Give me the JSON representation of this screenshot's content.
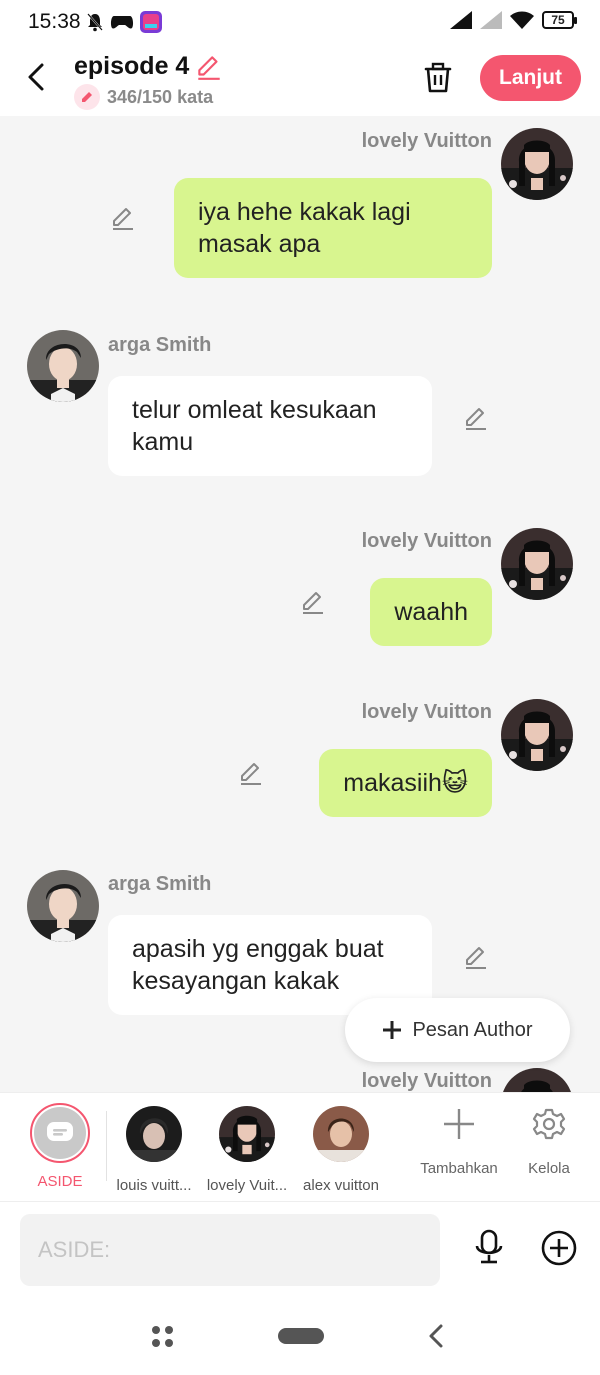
{
  "status": {
    "time": "15:38",
    "battery": "75",
    "left_icons": [
      "mute-bell-icon",
      "gamepad-icon",
      "app-notification-icon"
    ],
    "right_icons": [
      "signal-icon",
      "signal-weak-icon",
      "wifi-icon",
      "battery-icon"
    ]
  },
  "header": {
    "title": "episode 4",
    "word_count": "346/150 kata",
    "next_label": "Lanjut"
  },
  "messages": [
    {
      "sender": "lovely Vuitton",
      "text": "iya hehe kakak lagi masak apa",
      "side": "right"
    },
    {
      "sender": "arga Smith",
      "text": "telur omleat kesukaan kamu",
      "side": "left"
    },
    {
      "sender": "lovely Vuitton",
      "text": "waahh",
      "side": "right"
    },
    {
      "sender": "lovely Vuitton",
      "text": "makasiih😺",
      "side": "right"
    },
    {
      "sender": "arga Smith",
      "text": "apasih yg enggak buat kesayangan kakak",
      "side": "left"
    },
    {
      "sender": "lovely Vuitton",
      "text": "",
      "side": "right"
    }
  ],
  "author_button": "Pesan Author",
  "characters": {
    "aside_label": "ASIDE",
    "items": [
      {
        "name": "louis vuitt..."
      },
      {
        "name": "lovely Vuit..."
      },
      {
        "name": "alex vuitton"
      }
    ],
    "add_label": "Tambahkan",
    "manage_label": "Kelola"
  },
  "composer": {
    "placeholder": "ASIDE:"
  },
  "colors": {
    "accent": "#f4566f",
    "my_bubble": "#d8f58f",
    "their_bubble": "#ffffff",
    "background": "#f5f5f5"
  }
}
